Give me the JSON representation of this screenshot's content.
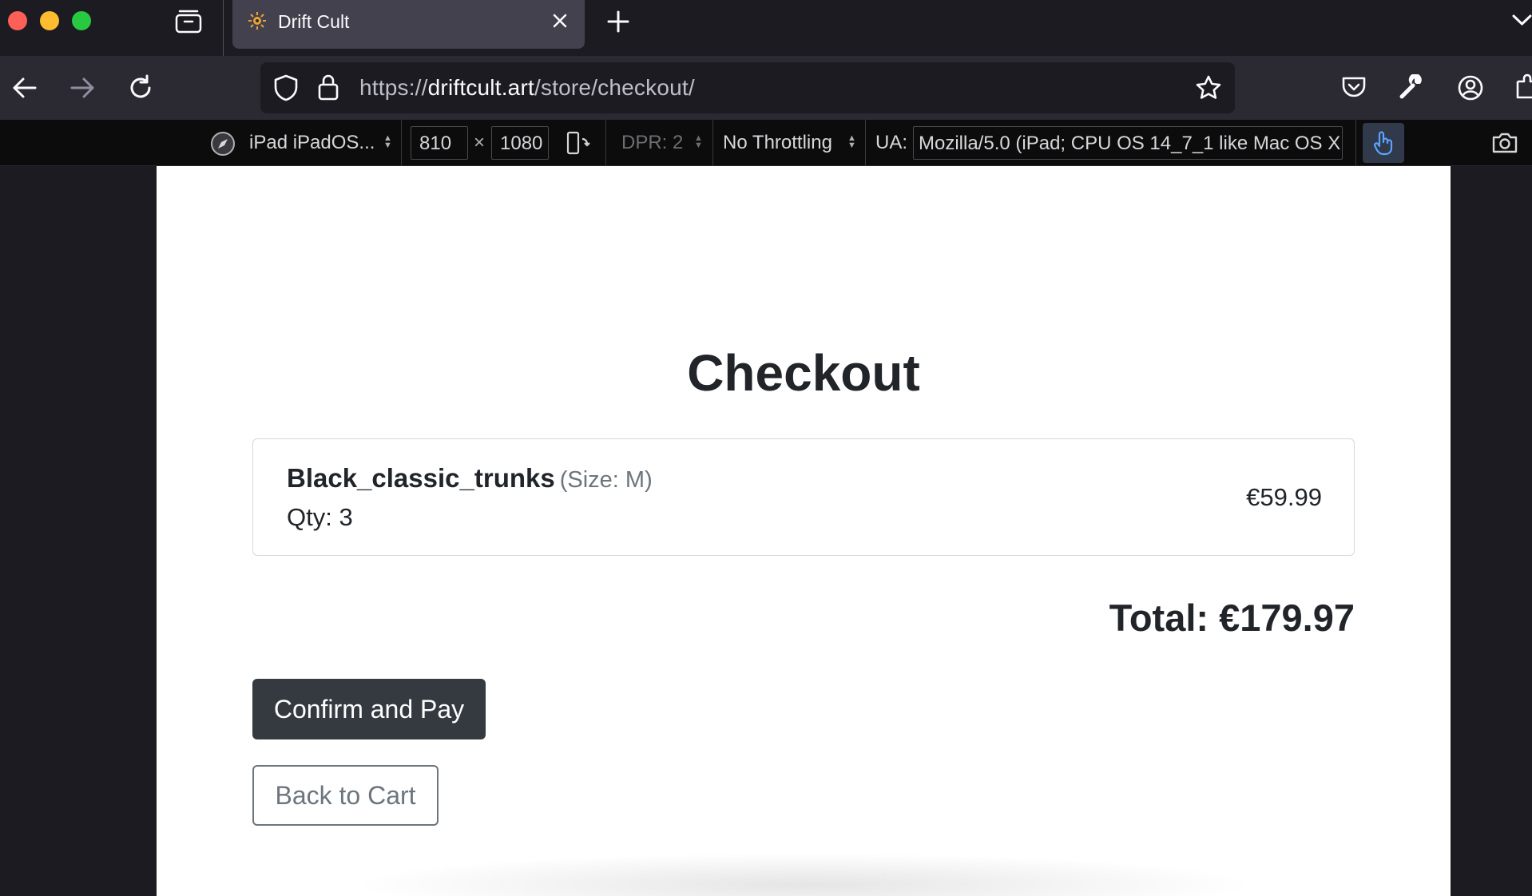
{
  "browser": {
    "tab": {
      "title": "Drift Cult"
    },
    "url": {
      "scheme": "https://",
      "host": "driftcult.art",
      "path": "/store/checkout/"
    }
  },
  "devtools": {
    "device": "iPad iPadOS...",
    "width": "810",
    "height": "1080",
    "times": "×",
    "dpr": "DPR: 2",
    "throttling": "No Throttling",
    "ua_label": "UA:",
    "ua_value": "Mozilla/5.0 (iPad; CPU OS 14_7_1 like Mac OS X"
  },
  "page": {
    "title": "Checkout",
    "item": {
      "name": "Black_classic_trunks",
      "size": "(Size: M)",
      "qty": "Qty: 3",
      "price": "€59.99"
    },
    "total": "Total: €179.97",
    "confirm_label": "Confirm and Pay",
    "back_label": "Back to Cart"
  },
  "colors": {
    "confirm_bg": "#343a40",
    "text": "#212529",
    "muted": "#6c757d",
    "chrome_bg": "#1c1b22",
    "toolbar_bg": "#2b2a33"
  },
  "icons": [
    "tab-overview-icon",
    "favicon-icon",
    "close-icon",
    "new-tab-icon",
    "tab-list-chevron-icon",
    "back-icon",
    "forward-icon",
    "reload-icon",
    "shield-icon",
    "lock-icon",
    "bookmark-star-icon",
    "pocket-icon",
    "wrench-icon",
    "account-icon",
    "extensions-icon",
    "compass-icon",
    "rotate-device-icon",
    "touch-simulation-icon",
    "screenshot-icon"
  ]
}
